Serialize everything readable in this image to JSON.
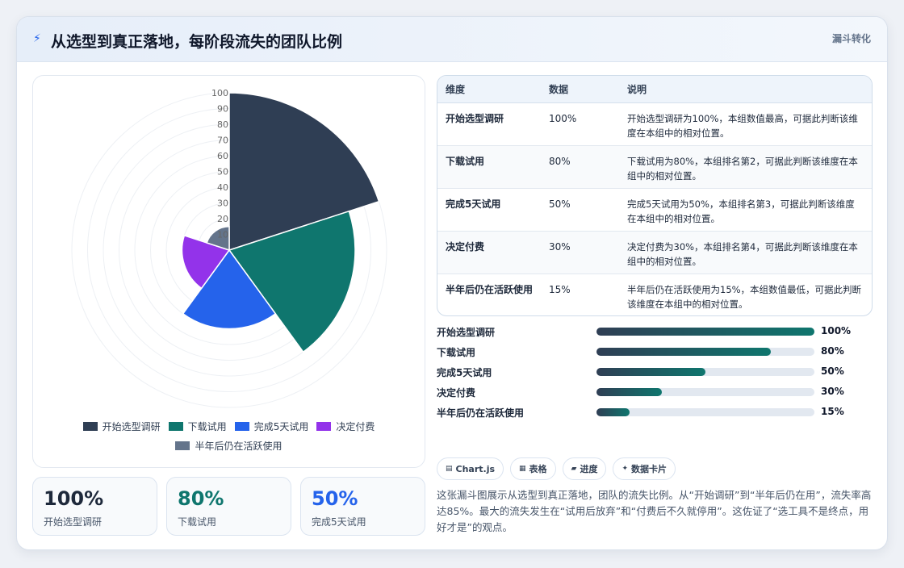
{
  "header": {
    "title": "从选型到真正落地，每阶段流失的团队比例",
    "tag": "漏斗转化"
  },
  "chart_data": {
    "type": "polarArea",
    "categories": [
      "开始选型调研",
      "下载试用",
      "完成5天试用",
      "决定付费",
      "半年后仍在活跃使用"
    ],
    "values": [
      100,
      80,
      50,
      30,
      15
    ],
    "colors": [
      "#2f3e54",
      "#0f766e",
      "#2563eb",
      "#9333ea",
      "#64748b"
    ],
    "r_range": [
      0,
      100
    ],
    "r_ticks": [
      "10",
      "20",
      "30",
      "40",
      "50",
      "60",
      "70",
      "80",
      "90",
      "100"
    ],
    "legend_position": "bottom"
  },
  "kpis": [
    {
      "value": "100%",
      "label": "开始选型调研",
      "color": "#1e293b"
    },
    {
      "value": "80%",
      "label": "下载试用",
      "color": "#0f766e"
    },
    {
      "value": "50%",
      "label": "完成5天试用",
      "color": "#2563eb"
    }
  ],
  "table": {
    "headers": [
      "维度",
      "数据",
      "说明"
    ],
    "rows": [
      {
        "dim": "开始选型调研",
        "val": "100%",
        "note": "开始选型调研为100%，本组数值最高，可据此判断该维度在本组中的相对位置。"
      },
      {
        "dim": "下载试用",
        "val": "80%",
        "note": "下载试用为80%，本组排名第2，可据此判断该维度在本组中的相对位置。"
      },
      {
        "dim": "完成5天试用",
        "val": "50%",
        "note": "完成5天试用为50%，本组排名第3，可据此判断该维度在本组中的相对位置。"
      },
      {
        "dim": "决定付费",
        "val": "30%",
        "note": "决定付费为30%，本组排名第4，可据此判断该维度在本组中的相对位置。"
      },
      {
        "dim": "半年后仍在活跃使用",
        "val": "15%",
        "note": "半年后仍在活跃使用为15%，本组数值最低，可据此判断该维度在本组中的相对位置。"
      }
    ]
  },
  "progress": [
    {
      "label": "开始选型调研",
      "value": 100,
      "text": "100%"
    },
    {
      "label": "下载试用",
      "value": 80,
      "text": "80%"
    },
    {
      "label": "完成5天试用",
      "value": 50,
      "text": "50%"
    },
    {
      "label": "决定付费",
      "value": 30,
      "text": "30%"
    },
    {
      "label": "半年后仍在活跃使用",
      "value": 15,
      "text": "15%"
    }
  ],
  "chips": [
    {
      "icon": "▤",
      "label": "Chart.js"
    },
    {
      "icon": "▦",
      "label": "表格"
    },
    {
      "icon": "▰",
      "label": "进度"
    },
    {
      "icon": "✦",
      "label": "数据卡片"
    }
  ],
  "description": "这张漏斗图展示从选型到真正落地，团队的流失比例。从“开始调研”到“半年后仍在用”，流失率高达85%。最大的流失发生在“试用后放弃”和“付费后不久就停用”。这佐证了“选工具不是终点，用好才是”的观点。"
}
